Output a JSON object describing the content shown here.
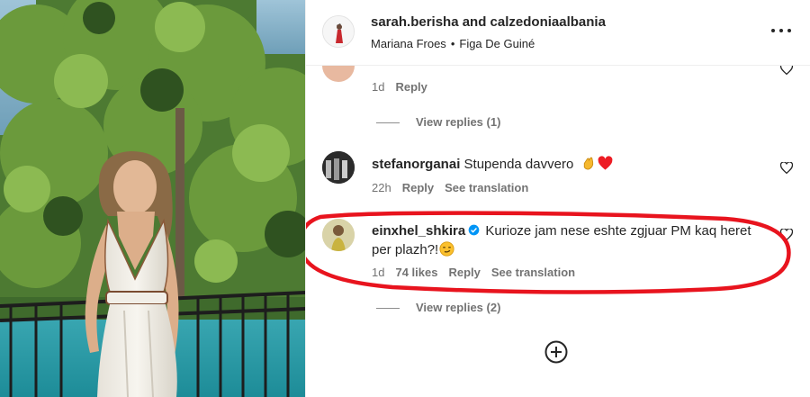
{
  "header": {
    "title": "sarah.berisha and calzedoniaalbania",
    "subtitle_left": "Mariana Froes",
    "subtitle_sep": "•",
    "subtitle_right": "Figa De Guiné",
    "more_icon": "more-horizontal-icon"
  },
  "comments": [
    {
      "id": "partial",
      "time": "1d",
      "reply_label": "Reply",
      "view_replies": "View replies (1)"
    },
    {
      "id": "stefano",
      "username": "stefanorganai",
      "text": "Stupenda davvero",
      "emojis": [
        "clapping-hands-emoji",
        "red-heart-emoji"
      ],
      "time": "22h",
      "reply_label": "Reply",
      "translate_label": "See translation"
    },
    {
      "id": "einxhel",
      "username": "einxhel_shkira",
      "verified": true,
      "text": "Kurioze jam nese eshte zgjuar PM kaq heret per plazh?!",
      "emojis": [
        "smirking-face-emoji"
      ],
      "time": "1d",
      "likes": "74 likes",
      "reply_label": "Reply",
      "translate_label": "See translation",
      "view_replies": "View replies (2)"
    }
  ],
  "load_more_icon": "plus-circle-icon",
  "colors": {
    "text": "#262626",
    "secondary": "#737373",
    "verified": "#0095f6",
    "annotation": "#e8141e",
    "heart": "#ed1c24"
  }
}
